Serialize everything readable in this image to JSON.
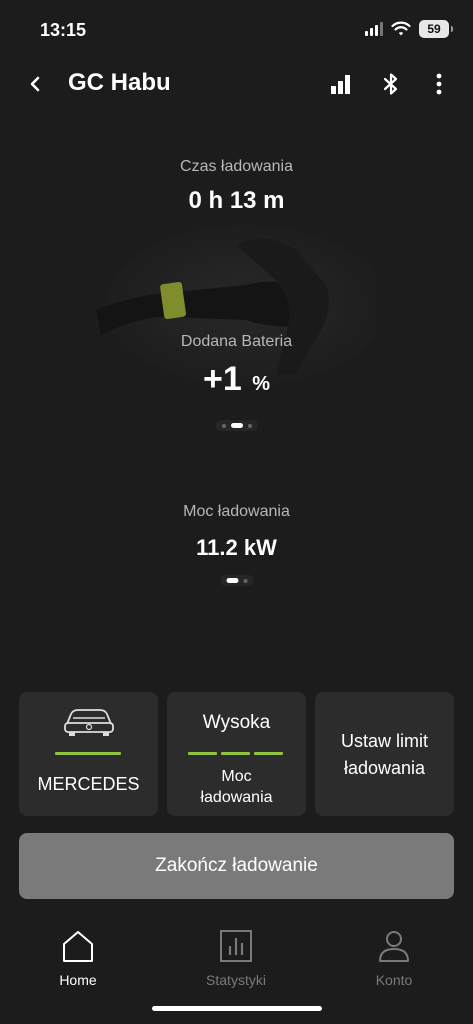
{
  "status_bar": {
    "time": "13:15",
    "battery": "59"
  },
  "header": {
    "title": "GC Habu"
  },
  "metrics": {
    "charge_time": {
      "label": "Czas ładowania",
      "value": "0 h 13 m"
    },
    "added_battery": {
      "label": "Dodana Bateria",
      "value": "+1",
      "unit": "%"
    },
    "charge_power": {
      "label": "Moc ładowania",
      "value": "11.2 kW"
    }
  },
  "cards": {
    "vehicle": {
      "label": "MERCEDES"
    },
    "power_level": {
      "value": "Wysoka",
      "label": "Moc ładowania"
    },
    "limit": {
      "label": "Ustaw limit ładowania"
    }
  },
  "end_button": {
    "label": "Zakończ ładowanie"
  },
  "nav": {
    "home": "Home",
    "stats": "Statystyki",
    "account": "Konto"
  },
  "colors": {
    "background": "#1c1c1c",
    "card": "#2c2c2c",
    "accent_green": "#8ec43d",
    "button_grey": "#7a7a7a",
    "inactive_nav": "#7a7a7a"
  },
  "icons": {
    "back": "chevron-left-icon",
    "signal": "signal-bars-icon",
    "bluetooth": "bluetooth-icon",
    "more": "more-vertical-icon",
    "car": "car-icon",
    "home": "home-icon",
    "stats": "bar-chart-icon",
    "account": "user-icon"
  }
}
